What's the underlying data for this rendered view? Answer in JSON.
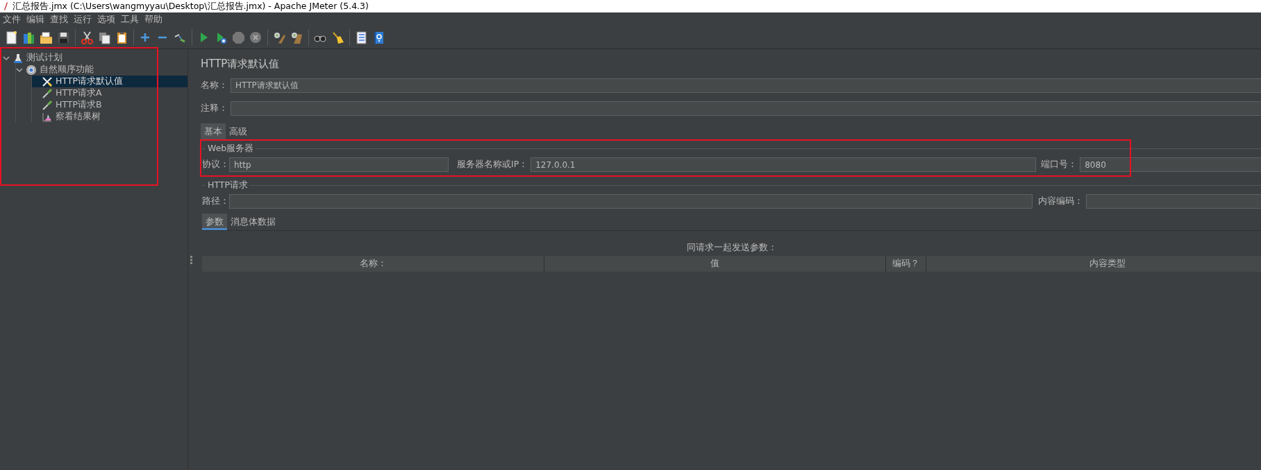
{
  "window": {
    "title": "汇总报告.jmx (C:\\Users\\wangmyyau\\Desktop\\汇总报告.jmx) - Apache JMeter (5.4.3)"
  },
  "menu": [
    "文件",
    "编辑",
    "查找",
    "运行",
    "选项",
    "工具",
    "帮助"
  ],
  "tree": {
    "highlighted": true,
    "items": [
      {
        "label": "测试计划",
        "kind": "plan",
        "expanded": true,
        "selected": false,
        "children": [
          {
            "label": "自然顺序功能",
            "kind": "controller",
            "expanded": true,
            "selected": false,
            "children": [
              {
                "label": "HTTP请求默认值",
                "kind": "config",
                "selected": true
              },
              {
                "label": "HTTP请求A",
                "kind": "sampler",
                "selected": false
              },
              {
                "label": "HTTP请求B",
                "kind": "sampler",
                "selected": false
              },
              {
                "label": "察看结果树",
                "kind": "listener",
                "selected": false
              }
            ]
          }
        ]
      }
    ]
  },
  "panel": {
    "title": "HTTP请求默认值",
    "name": {
      "label": "名称：",
      "value": "HTTP请求默认值"
    },
    "comment": {
      "label": "注释："
    },
    "tabs": [
      {
        "label": "基本",
        "selected": true
      },
      {
        "label": "高级",
        "selected": false
      }
    ],
    "web_server": {
      "title": "Web服务器",
      "highlighted": true,
      "protocol": {
        "label": "协议：",
        "value": "http"
      },
      "server": {
        "label": "服务器名称或IP：",
        "value": "127.0.0.1"
      },
      "port": {
        "label": "端口号：",
        "value": "8080"
      }
    },
    "http_request": {
      "title": "HTTP请求",
      "path": {
        "label": "路径："
      },
      "encoding": {
        "label": "内容编码："
      }
    },
    "param_tabs": [
      {
        "label": "参数",
        "selected": true
      },
      {
        "label": "消息体数据",
        "selected": false
      }
    ],
    "params_caption": "同请求一起发送参数：",
    "table": {
      "columns": [
        "名称：",
        "值",
        "编码？",
        "内容类型"
      ]
    }
  }
}
